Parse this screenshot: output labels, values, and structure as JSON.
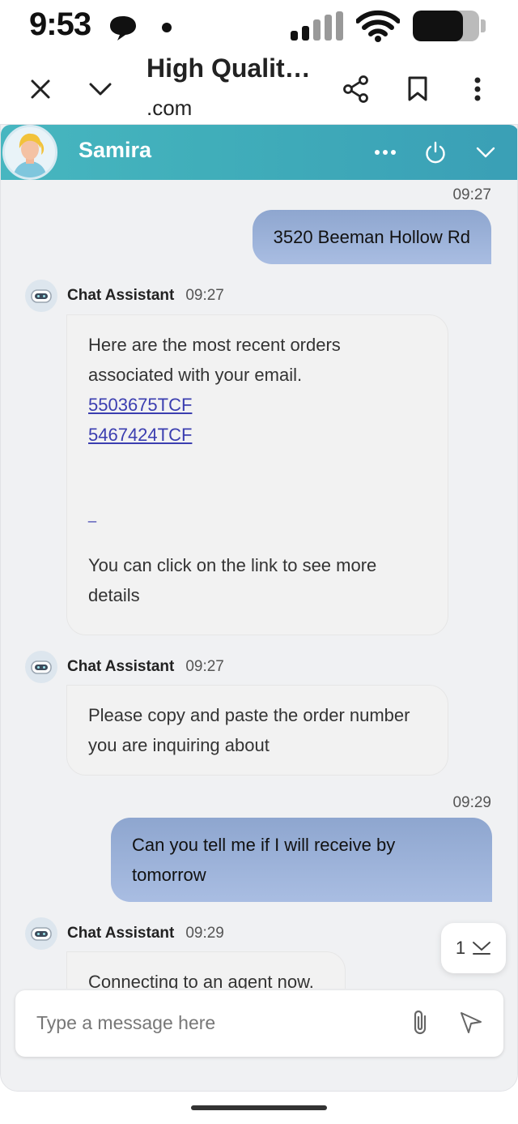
{
  "status_bar": {
    "time": "9:53",
    "icons": [
      "chat-bubble-icon",
      "dot-icon",
      "cell-signal-icon",
      "wifi-icon",
      "battery-icon"
    ],
    "battery_level": 0.75
  },
  "browser": {
    "title": "High Qualit…",
    "url": ".com",
    "icons": [
      "close-icon",
      "chevron-down-icon",
      "share-icon",
      "bookmark-icon",
      "more-vertical-icon"
    ]
  },
  "chat": {
    "header": {
      "agent_name": "Samira",
      "accent": "#40aeba",
      "icons": [
        "more-horizontal-icon",
        "power-icon",
        "chevron-down-icon"
      ]
    },
    "messages": [
      {
        "from": "user",
        "time": "09:27",
        "text": "3520 Beeman Hollow Rd"
      },
      {
        "from": "bot",
        "sender": "Chat Assistant",
        "time": "09:27",
        "intro": "Here are the most recent orders associated with your email.",
        "links": [
          "5503675TCF",
          "5467424TCF"
        ],
        "stray_link": "_",
        "outro": "You can click on the link to see more details"
      },
      {
        "from": "bot",
        "sender": "Chat Assistant",
        "time": "09:27",
        "text": "Please copy and paste the order number you are inquiring about"
      },
      {
        "from": "user",
        "time": "09:29",
        "text": "Can you tell me if I will receive by tomorrow"
      },
      {
        "from": "bot",
        "sender": "Chat Assistant",
        "time": "09:29",
        "text": "Connecting to an agent now."
      }
    ],
    "scroll_badge": {
      "count": "1"
    },
    "composer": {
      "placeholder": "Type a message here"
    },
    "user_bubble_color": "#a9bde2",
    "link_color": "#3b3eb0"
  }
}
